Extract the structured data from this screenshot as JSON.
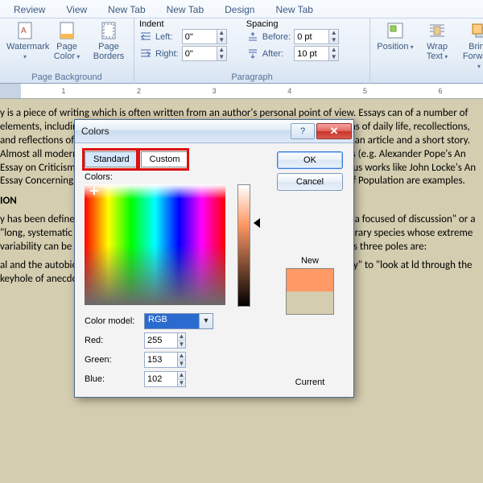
{
  "tabs": [
    "Review",
    "View",
    "New Tab",
    "New Tab",
    "Design",
    "New Tab"
  ],
  "ribbon": {
    "pageBackground": {
      "label": "Page Background",
      "watermark": "Watermark",
      "pageColor": "Page Color",
      "pageBorders": "Page Borders"
    },
    "paragraph": {
      "label": "Paragraph",
      "indent": "Indent",
      "left": "Left:",
      "right": "Right:",
      "leftVal": "0\"",
      "rightVal": "0\"",
      "spacing": "Spacing",
      "before": "Before:",
      "after": "After:",
      "beforeVal": "0 pt",
      "afterVal": "10 pt"
    },
    "arrange": {
      "position": "Position",
      "wrap": "Wrap Text",
      "bring": "Bring Forward"
    }
  },
  "ruler": {
    "marks": [
      "",
      "1",
      "",
      "2",
      "",
      "3",
      "",
      "4",
      "",
      "5",
      "",
      "6",
      ""
    ]
  },
  "document": {
    "p1": "y is a piece of writing which is often written from an author's personal point of view. Essays can of a number of elements, including: literary criticism, political manifestos, learned arguments, ations of daily life, recollections, and reflections of the author. The definition of an essay is vague, ping with those of an article and a short story. Almost all modern essays are written in prose, but a verse have been dubbed essays (e.g. Alexander Pope's An Essay on Criticism and An Essay on While brevity usually defines an essay, voluminous works like John Locke's An Essay Concerning Understanding and Thomas Malthus's An Essay on the Principle of Population are examples.",
    "h1": "ION",
    "p2": "y has been defined in a variety of ways. One definition is a \"prose composition with a focused of discussion\" or a \"long, systematic discourse\". Aldous Huxley notes on occasions that \"essays to a literary species whose extreme variability can be studied most effectively within a three-ame of reference\". Huxley's three poles are:",
    "p3": "al and the autobiographical essays: these use \"fragments of reflective autobiography\" to \"look at ld through the keyhole of anecdote and description\"."
  },
  "dialog": {
    "title": "Colors",
    "tabs": {
      "standard": "Standard",
      "custom": "Custom"
    },
    "colorsLabel": "Colors:",
    "modelLabel": "Color model:",
    "modelValue": "RGB",
    "redLabel": "Red:",
    "redValue": "255",
    "greenLabel": "Green:",
    "greenValue": "153",
    "blueLabel": "Blue:",
    "blueValue": "102",
    "ok": "OK",
    "cancel": "Cancel",
    "new": "New",
    "current": "Current",
    "newColor": "#ff9966",
    "currentColor": "#d4cdb0"
  }
}
